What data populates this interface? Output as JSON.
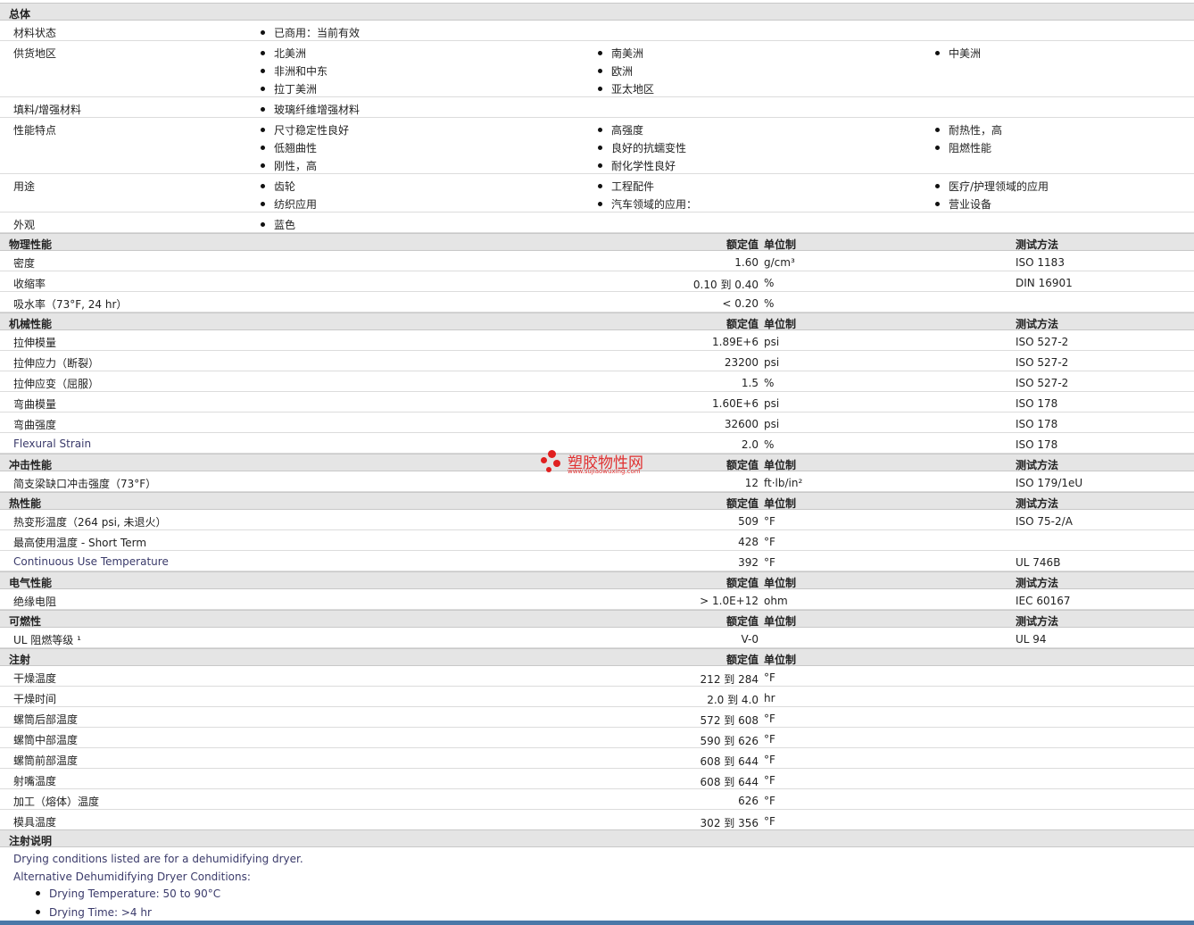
{
  "general": {
    "title": "总体",
    "rows": [
      {
        "label": "材料状态",
        "items": [
          [
            "已商用：当前有效"
          ]
        ]
      },
      {
        "label": "供货地区",
        "items": [
          [
            "北美洲",
            "非洲和中东",
            "拉丁美洲"
          ],
          [
            "南美洲",
            "欧洲",
            "亚太地区"
          ],
          [
            "中美洲"
          ]
        ]
      },
      {
        "label": "填料/增强材料",
        "items": [
          [
            "玻璃纤维增强材料"
          ]
        ]
      },
      {
        "label": "性能特点",
        "items": [
          [
            "尺寸稳定性良好",
            "低翘曲性",
            "刚性，高"
          ],
          [
            "高强度",
            "良好的抗蠕变性",
            "耐化学性良好"
          ],
          [
            "耐热性，高",
            "阻燃性能"
          ]
        ]
      },
      {
        "label": "用途",
        "items": [
          [
            "齿轮",
            "纺织应用"
          ],
          [
            "工程配件",
            "汽车领域的应用："
          ],
          [
            "医疗/护理领域的应用",
            "营业设备"
          ]
        ]
      },
      {
        "label": "外观",
        "items": [
          [
            "蓝色"
          ]
        ]
      }
    ]
  },
  "headers": {
    "value": "额定值",
    "unit": "单位制",
    "test": "测试方法"
  },
  "sections": [
    {
      "title": "物理性能",
      "test": true,
      "rows": [
        {
          "label": "密度",
          "value": "1.60",
          "unit": "g/cm³",
          "test": "ISO 1183"
        },
        {
          "label": "收缩率",
          "value": "0.10 到  0.40",
          "unit": "%",
          "test": "DIN 16901"
        },
        {
          "label": "吸水率（73°F, 24 hr）",
          "value": "< 0.20",
          "unit": "%",
          "test": ""
        }
      ]
    },
    {
      "title": "机械性能",
      "test": true,
      "rows": [
        {
          "label": "拉伸模量",
          "value": "1.89E+6",
          "unit": "psi",
          "test": "ISO 527-2"
        },
        {
          "label": "拉伸应力（断裂）",
          "value": "23200",
          "unit": "psi",
          "test": "ISO 527-2"
        },
        {
          "label": "拉伸应变（屈服）",
          "value": "1.5",
          "unit": "%",
          "test": "ISO 527-2"
        },
        {
          "label": "弯曲模量",
          "value": "1.60E+6",
          "unit": "psi",
          "test": "ISO 178"
        },
        {
          "label": "弯曲强度",
          "value": "32600",
          "unit": "psi",
          "test": "ISO 178"
        },
        {
          "label": "Flexural Strain",
          "value": "2.0",
          "unit": "%",
          "test": "ISO 178",
          "link": true
        }
      ]
    },
    {
      "title": "冲击性能",
      "test": true,
      "rows": [
        {
          "label": "简支梁缺口冲击强度（73°F）",
          "value": "12",
          "unit": "ft·lb/in²",
          "test": "ISO 179/1eU"
        }
      ]
    },
    {
      "title": "热性能",
      "test": true,
      "rows": [
        {
          "label": "热变形温度（264 psi, 未退火）",
          "value": "509",
          "unit": "°F",
          "test": "ISO 75-2/A"
        },
        {
          "label": "最高使用温度 - Short Term",
          "value": "428",
          "unit": "°F",
          "test": ""
        },
        {
          "label": "Continuous Use Temperature",
          "value": "392",
          "unit": "°F",
          "test": "UL 746B",
          "link": true
        }
      ]
    },
    {
      "title": "电气性能",
      "test": true,
      "rows": [
        {
          "label": "绝缘电阻",
          "value": "> 1.0E+12",
          "unit": "ohm",
          "test": "IEC 60167"
        }
      ]
    },
    {
      "title": "可燃性",
      "test": true,
      "rows": [
        {
          "label": "UL 阻燃等级 ¹",
          "value": "V-0",
          "unit": "",
          "test": "UL 94"
        }
      ]
    },
    {
      "title": "注射",
      "test": false,
      "rows": [
        {
          "label": "干燥温度",
          "value": "212 到  284",
          "unit": "°F",
          "test": ""
        },
        {
          "label": "干燥时间",
          "value": "2.0 到  4.0",
          "unit": "hr",
          "test": ""
        },
        {
          "label": "螺筒后部温度",
          "value": "572 到  608",
          "unit": "°F",
          "test": ""
        },
        {
          "label": "螺筒中部温度",
          "value": "590 到  626",
          "unit": "°F",
          "test": ""
        },
        {
          "label": "螺筒前部温度",
          "value": "608 到  644",
          "unit": "°F",
          "test": ""
        },
        {
          "label": "射嘴温度",
          "value": "608 到  644",
          "unit": "°F",
          "test": ""
        },
        {
          "label": "加工（熔体）温度",
          "value": "626",
          "unit": "°F",
          "test": ""
        },
        {
          "label": "模具温度",
          "value": "302 到  356",
          "unit": "°F",
          "test": ""
        }
      ]
    }
  ],
  "notes": {
    "title": "注射说明",
    "lines": [
      "Drying conditions listed are for a dehumidifying dryer.",
      "Alternative Dehumidifying Dryer Conditions:"
    ],
    "bullets": [
      "Drying Temperature: 50 to 90°C",
      "Drying Time: >4 hr"
    ]
  },
  "watermark": {
    "text": "塑胶物性网",
    "sub": "www.sujiaowuxing.com",
    "color": "#e02020"
  }
}
